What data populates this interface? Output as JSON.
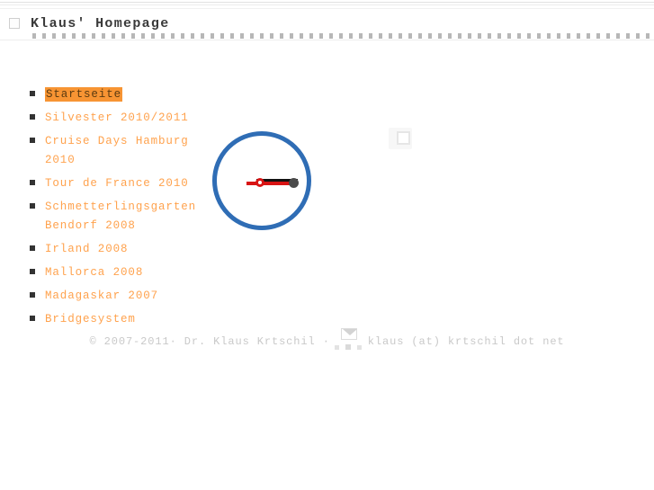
{
  "header": {
    "title": "Klaus' Homepage",
    "placeholder_icon": "broken-image-icon"
  },
  "nav": {
    "items": [
      {
        "label": "Startseite",
        "active": true
      },
      {
        "label": "Silvester 2010/2011",
        "active": false
      },
      {
        "label": "Cruise Days Hamburg 2010",
        "active": false
      },
      {
        "label": "Tour de France 2010",
        "active": false
      },
      {
        "label": "Schmetterlingsgarten Bendorf 2008",
        "active": false
      },
      {
        "label": "Irland 2008",
        "active": false
      },
      {
        "label": "Mallorca 2008",
        "active": false
      },
      {
        "label": "Madagaskar 2007",
        "active": false
      },
      {
        "label": "Bridgesystem",
        "active": false
      }
    ]
  },
  "main": {
    "placeholder_icon": "broken-image-icon",
    "spinner_icon": "loading-circle-icon"
  },
  "footer": {
    "copyright": "© 2007-2011· Dr. Klaus Krtschil ·",
    "mail_icon": "envelope-icon",
    "email": "klaus (at) krtschil dot net"
  },
  "colors": {
    "link": "#FFA24D",
    "active_bg": "#F79433",
    "ring": "#2F6DB5",
    "hand_red": "#D81414",
    "title": "#3A3A3A",
    "footer_text": "#C9C9C9"
  }
}
